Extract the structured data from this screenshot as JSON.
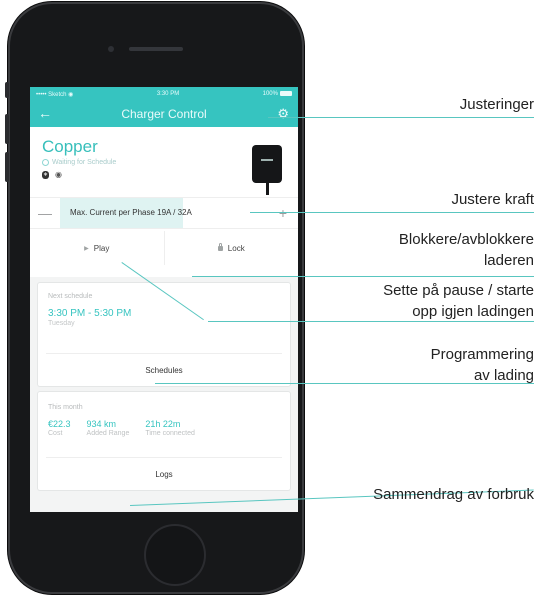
{
  "app": {
    "statusbar": {
      "carrier": "••••• Sketch ◉",
      "time": "3:30 PM",
      "battery": "100%"
    },
    "nav": {
      "title": "Charger Control"
    },
    "charger": {
      "name": "Copper",
      "status": "Waiting for Schedule"
    },
    "power": {
      "label": "Max. Current per Phase 19A / 32A",
      "fill_percent": 59
    },
    "actions": {
      "play": "Play",
      "lock": "Lock"
    },
    "schedule": {
      "header": "Next schedule",
      "time": "3:30 PM - 5:30 PM",
      "day": "Tuesday",
      "button": "Schedules"
    },
    "stats": {
      "header": "This month",
      "items": [
        {
          "value": "€22.3",
          "label": "Cost"
        },
        {
          "value": "934 km",
          "label": "Added Range"
        },
        {
          "value": "21h 22m",
          "label": "Time connected"
        }
      ],
      "button": "Logs"
    }
  },
  "callouts": {
    "justeringer": "Justeringer",
    "justere_kraft": "Justere kraft",
    "blokkere_line1": "Blokkere/avblokkere",
    "blokkere_line2": "laderen",
    "pause_line1": "Sette på pause / starte",
    "pause_line2": "opp igjen ladingen",
    "prog_line1": "Programmering",
    "prog_line2": "av lading",
    "sammendrag": "Sammendrag av forbruk"
  },
  "colors": {
    "accent": "#36c4c0",
    "callout_line": "#59c6c0",
    "phone_body": "#17181a"
  }
}
